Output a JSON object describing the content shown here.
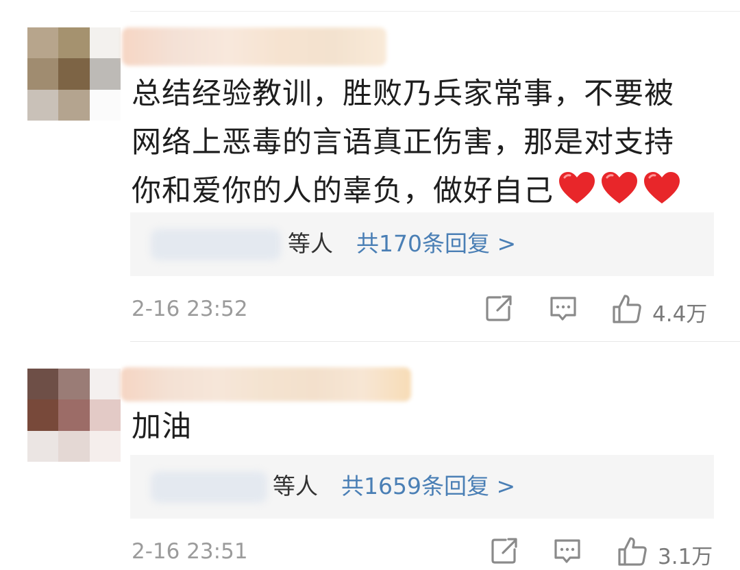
{
  "comments": [
    {
      "text": "总结经验教训，胜败乃兵家常事，不要被网络上恶毒的言语真正伤害，那是对支持你和爱你的人的辜负，做好自己",
      "emoji": "❤️❤️❤️",
      "reply_suffix": "等人",
      "reply_link": "共170条回复 >",
      "timestamp": "2-16 23:52",
      "like_count": "4.4万"
    },
    {
      "text": "加油",
      "reply_suffix": "等人",
      "reply_link": "共1659条回复 >",
      "timestamp": "2-16 23:51",
      "like_count": "3.1万"
    }
  ],
  "icons": {
    "share": "share-icon",
    "comment": "comment-icon",
    "like": "thumbs-up-icon",
    "emoji": "red-heart"
  },
  "colors": {
    "text": "#1e1e1e",
    "link": "#4a7fb5",
    "meta": "#9b9b9b",
    "reply_bg": "#f5f5f5",
    "heart": "#e8262a"
  }
}
